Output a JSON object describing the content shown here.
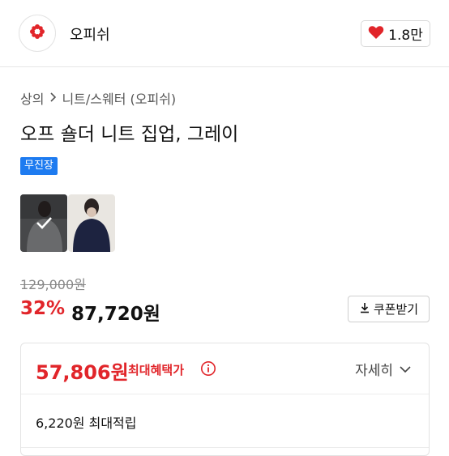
{
  "brand": {
    "name": "오피쉬",
    "logo_icon": "flower-logo-icon",
    "like_count": "1.8만",
    "like_icon": "heart-icon",
    "accent": "#e1252a"
  },
  "breadcrumb": {
    "category": "상의",
    "separator_icon": "chevron-right-icon",
    "subcategory": "니트/스웨터 (오피쉬)"
  },
  "product": {
    "title": "오프 숄더 니트 집업, 그레이",
    "badge": "무진장",
    "badge_color": "#1e7bf0",
    "thumbnails": [
      {
        "color": "gray",
        "selected": true
      },
      {
        "color": "navy",
        "selected": false
      }
    ],
    "original_price": "129,000원",
    "discount_rate": "32%",
    "sale_price": "87,720원",
    "coupon_label": "쿠폰받기",
    "coupon_icon": "download-icon"
  },
  "benefit": {
    "best_price": "57,806원",
    "best_label": "최대혜택가",
    "info_icon": "info-icon",
    "detail_label": "자세히",
    "detail_icon": "chevron-down-icon",
    "points": "6,220원 최대적립"
  }
}
